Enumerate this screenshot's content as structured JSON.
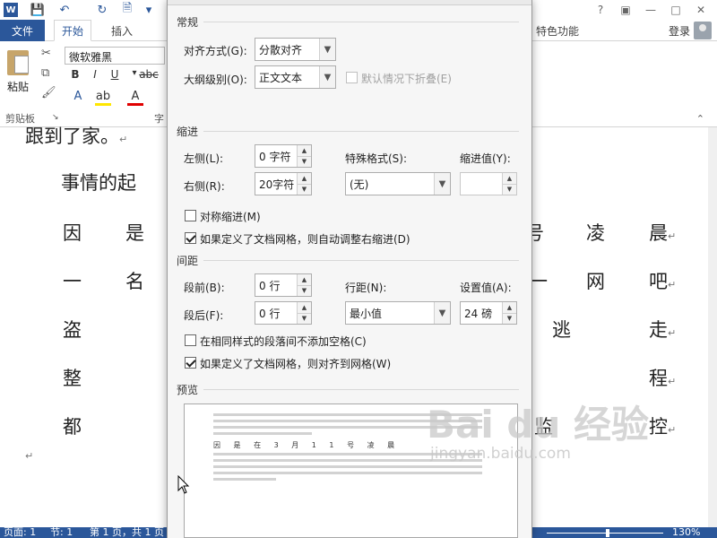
{
  "app": {
    "tabs": {
      "file": "文件",
      "home": "开始",
      "insert": "插入",
      "special": "特色功能"
    },
    "login": "登录",
    "font_name": "微软雅黑",
    "paste_label": "粘贴",
    "clipboard_label": "剪贴板",
    "font_group_label_fragment": "字",
    "help_icon": "?"
  },
  "document": {
    "line0": "跟到了家。",
    "line1_start": "事情的起",
    "row_a": [
      "因",
      "是",
      "号",
      "凌",
      "晨"
    ],
    "row_b": [
      "一",
      "名",
      "一",
      "网",
      "吧"
    ],
    "row_c": [
      "盗",
      "逃",
      "走"
    ],
    "row_d": [
      "整",
      "程"
    ],
    "row_e": [
      "都",
      "监",
      "控"
    ]
  },
  "status": {
    "page": "页面: 1",
    "section": "节: 1",
    "pages": "第 1 页，共 1 页",
    "zoom": "130%"
  },
  "dialog": {
    "general": {
      "title": "常规",
      "alignment_label": "对齐方式(G):",
      "alignment_value": "分散对齐",
      "outline_label": "大纲级别(O):",
      "outline_value": "正文文本",
      "collapse_label": "默认情况下折叠(E)"
    },
    "indent": {
      "title": "缩进",
      "left_label": "左侧(L):",
      "left_value": "0 字符",
      "right_label": "右侧(R):",
      "right_value": "20字符",
      "special_label": "特殊格式(S):",
      "special_value": "(无)",
      "by_label": "缩进值(Y):",
      "by_value": "",
      "mirror_label": "对称缩进(M)",
      "auto_adjust_label": "如果定义了文档网格，则自动调整右缩进(D)"
    },
    "spacing": {
      "title": "间距",
      "before_label": "段前(B):",
      "before_value": "0 行",
      "after_label": "段后(F):",
      "after_value": "0 行",
      "line_label": "行距(N):",
      "line_value": "最小值",
      "at_label": "设置值(A):",
      "at_value": "24 磅",
      "no_space_label": "在相同样式的段落间不添加空格(C)",
      "snap_label": "如果定义了文档网格，则对齐到网格(W)"
    },
    "preview": {
      "title": "预览",
      "sample_text": "因 是 在 3 月 1 1 号 凌 晨"
    }
  },
  "watermark": {
    "main": "Bai du 经验",
    "sub": "jingyan.baidu.com"
  },
  "colors": {
    "accent": "#2b579a",
    "dialog_bg": "#f6f6f6"
  }
}
